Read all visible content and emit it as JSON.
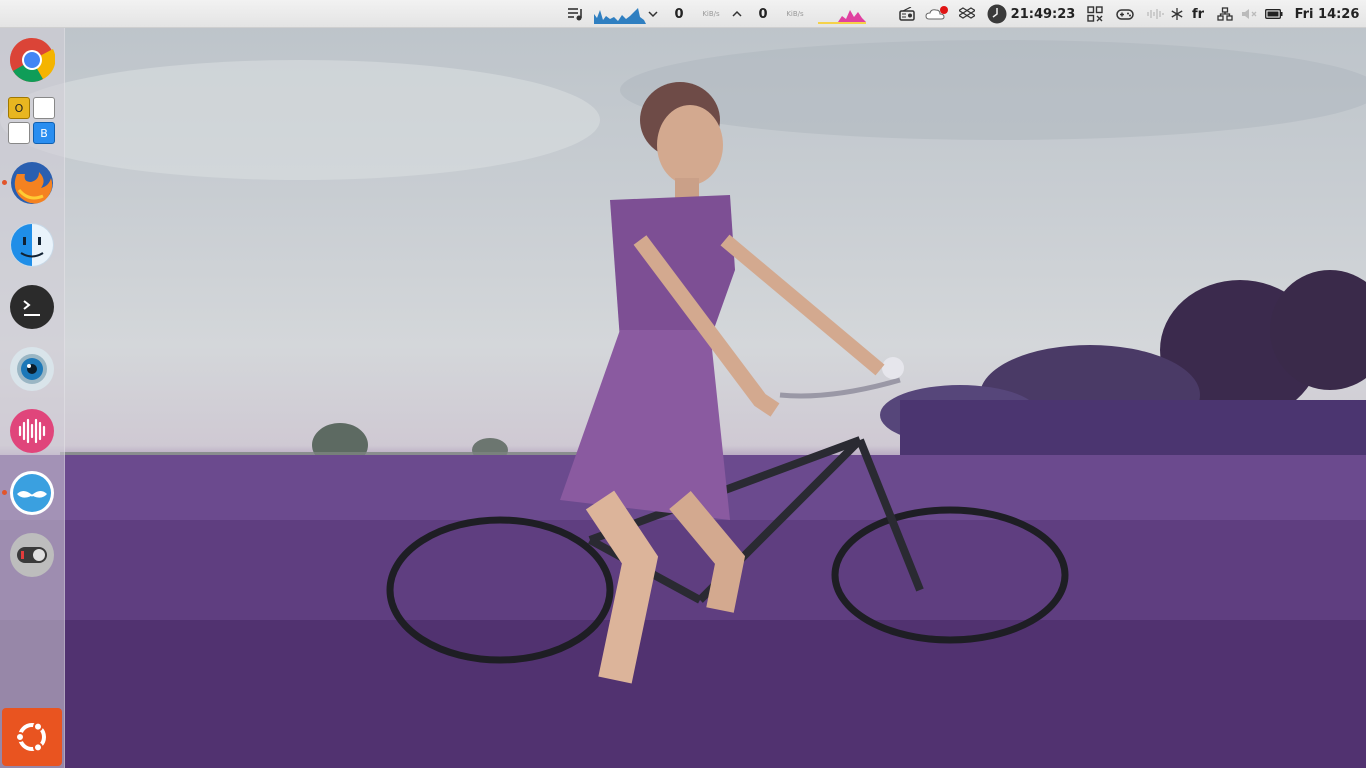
{
  "top_panel": {
    "net_down_value": "0",
    "net_down_unit": "KiB/s",
    "net_up_value": "0",
    "net_up_unit": "KiB/s",
    "alarm_time": "21:49:23",
    "keyboard_layout": "fr",
    "clock": "Fri 14:26"
  },
  "launcher": {
    "libreoffice_letters": {
      "top_left": "O",
      "bottom_right": "B"
    }
  },
  "colors": {
    "ubuntu_orange": "#e95420",
    "panel_bg": "#ebebeb",
    "running_pip": "#e2552b",
    "net_graph": "#2f7fc1",
    "cpu_graph": "#e040a0"
  }
}
